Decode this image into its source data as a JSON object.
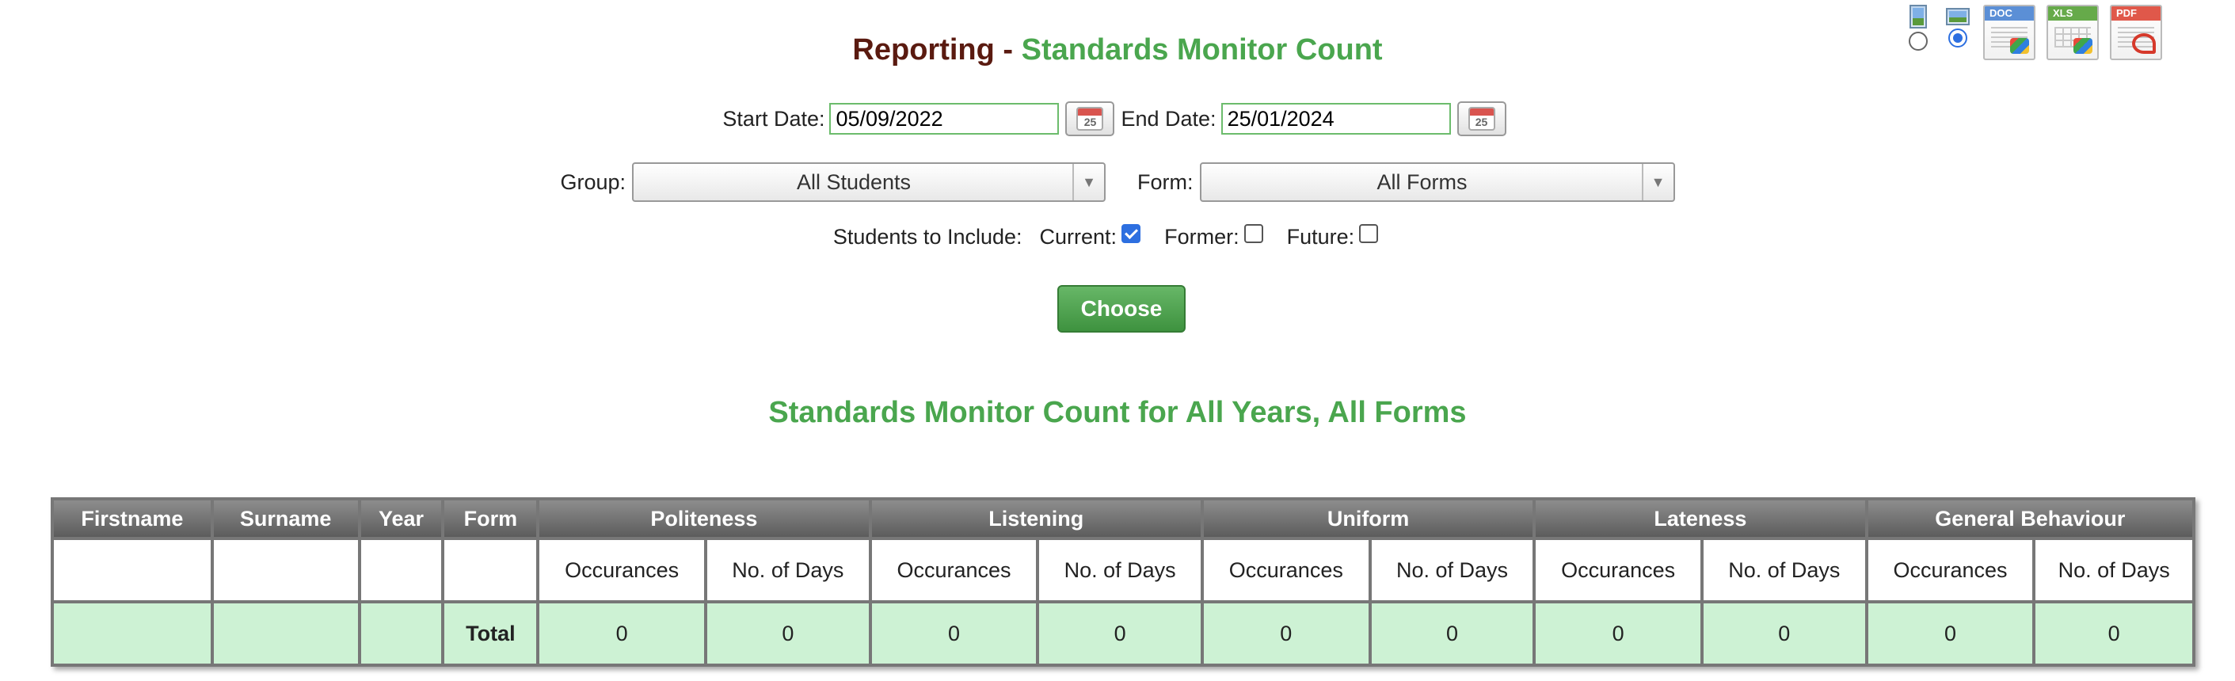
{
  "export": {
    "view_options": [
      {
        "name": "portrait",
        "selected": false
      },
      {
        "name": "landscape",
        "selected": true
      }
    ],
    "formats": [
      {
        "name": "doc",
        "label": "DOC",
        "color": "#5b8fd6"
      },
      {
        "name": "xls",
        "label": "XLS",
        "color": "#66aa4a"
      },
      {
        "name": "pdf",
        "label": "PDF",
        "color": "#e0584a"
      }
    ]
  },
  "title": {
    "prefix": "Reporting - ",
    "main": "Standards Monitor Count"
  },
  "filters": {
    "start_label": "Start Date:",
    "start_value": "05/09/2022",
    "end_label": "End Date:",
    "end_value": "25/01/2024",
    "calendar_day": "25",
    "group_label": "Group:",
    "group_value": "All Students",
    "form_label": "Form:",
    "form_value": "All Forms",
    "include_label": "Students to Include:",
    "current_label": "Current:",
    "current_checked": true,
    "former_label": "Former:",
    "former_checked": false,
    "future_label": "Future:",
    "future_checked": false
  },
  "choose_label": "Choose",
  "report_title": "Standards Monitor Count for All Years, All Forms",
  "table": {
    "fixed_columns": [
      "Firstname",
      "Surname",
      "Year",
      "Form"
    ],
    "groups": [
      "Politeness",
      "Listening",
      "Uniform",
      "Lateness",
      "General Behaviour"
    ],
    "sub_columns": [
      "Occurances",
      "No. of Days"
    ],
    "total_label": "Total",
    "totals": [
      "0",
      "0",
      "0",
      "0",
      "0",
      "0",
      "0",
      "0",
      "0",
      "0"
    ]
  },
  "colors": {
    "accent_green": "#4aa64e",
    "title_brown": "#5a1a10",
    "total_row": "#cdf2d4",
    "header_grey": "#6e6e6e"
  }
}
